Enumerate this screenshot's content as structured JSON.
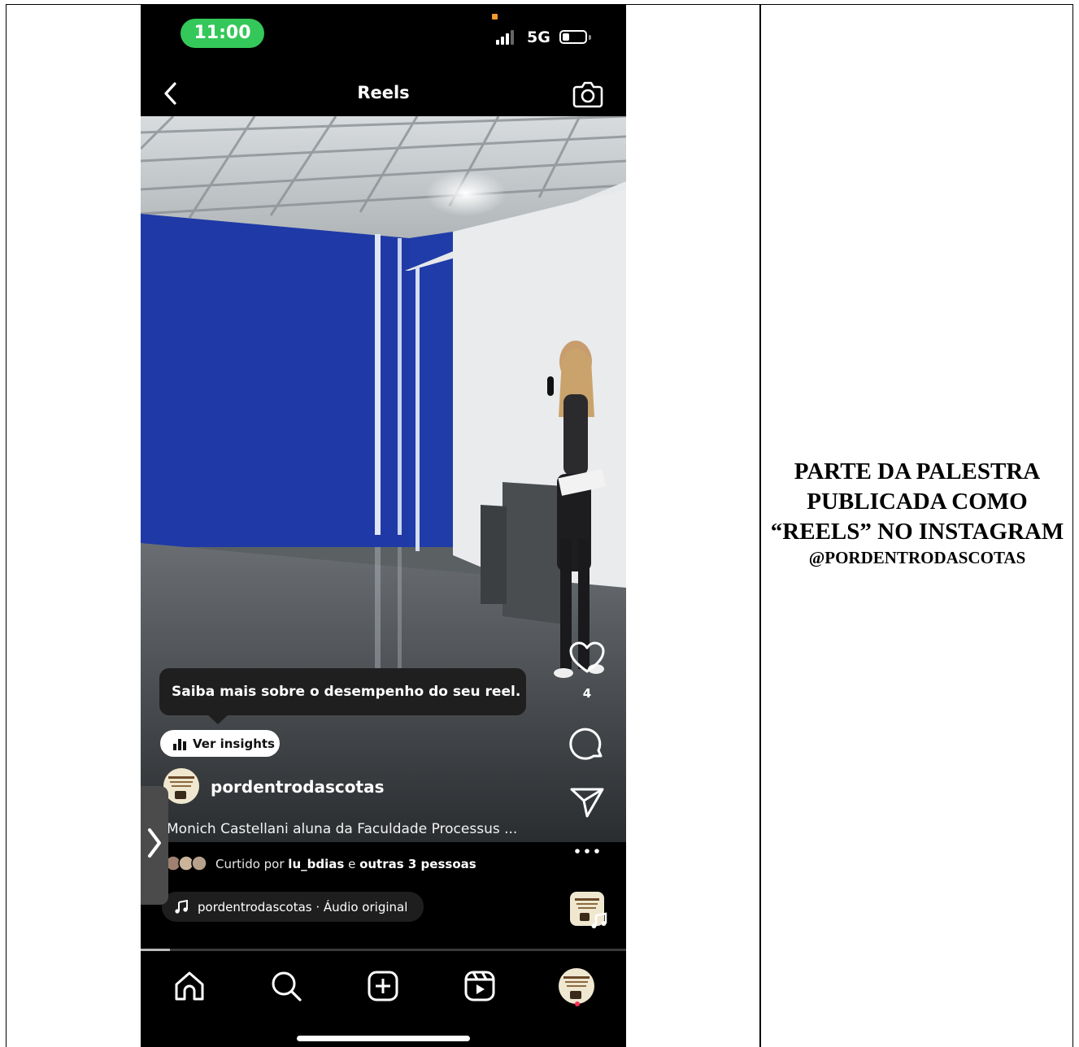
{
  "status_bar": {
    "time": "11:00",
    "network": "5G",
    "battery_level": 0.3
  },
  "nav": {
    "title": "Reels",
    "back_icon": "chevron-left-icon",
    "camera_icon": "camera-icon"
  },
  "tooltip": {
    "text": "Saiba mais sobre o desempenho do seu reel."
  },
  "insights": {
    "label": "Ver insights",
    "icon": "bar-chart-icon"
  },
  "post": {
    "username": "pordentrodascotas",
    "caption": "Monich Castellani aluna da Faculdade Processus ...",
    "liked_prefix": "Curtido por ",
    "liked_user": "lu_bdias",
    "liked_joiner": " e ",
    "liked_others": "outras 3 pessoas",
    "audio": "pordentrodascotas · Áudio original"
  },
  "actions": {
    "like_count": "4",
    "more": "more-icon"
  },
  "tabs": [
    "home-icon",
    "search-icon",
    "create-icon",
    "reels-icon",
    "profile-icon"
  ],
  "progress": 0.06,
  "side_caption": {
    "main": "PARTE DA PALESTRA PUBLICADA COMO “REELS” NO INSTAGRAM",
    "handle": "@PORDENTRODASCOTAS"
  },
  "colors": {
    "time_pill": "#34c759",
    "notification_dot": "#f29a2e",
    "profile_dot": "#ff2d55",
    "wall_blue": "#1f3aa6"
  }
}
